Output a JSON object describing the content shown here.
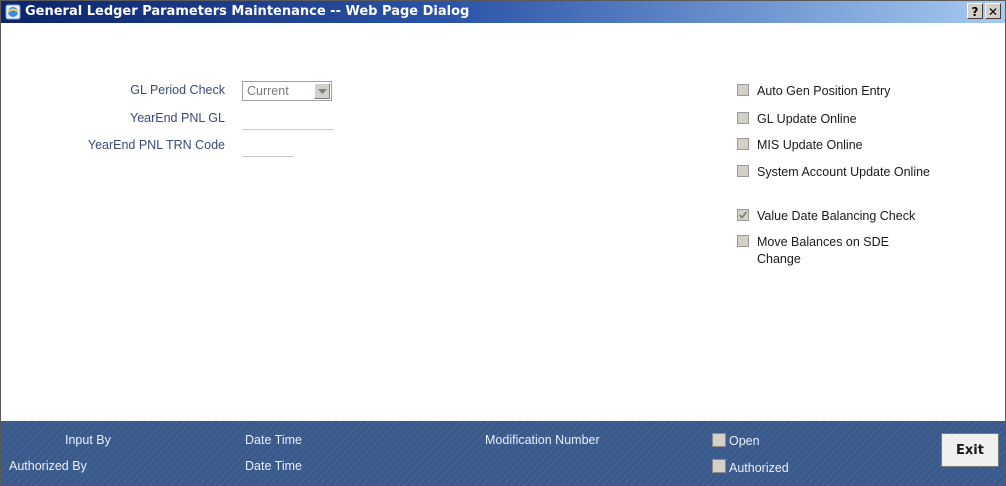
{
  "window": {
    "title": "General Ledger Parameters Maintenance -- Web Page Dialog",
    "help_label": "?",
    "close_label": "✕"
  },
  "form": {
    "gl_period_check": {
      "label": "GL Period Check",
      "value": "Current"
    },
    "yearend_pnl_gl": {
      "label": "YearEnd PNL GL",
      "value": ""
    },
    "yearend_pnl_trn_code": {
      "label": "YearEnd PNL TRN Code",
      "value": ""
    }
  },
  "options": [
    {
      "label": "Auto Gen Position Entry",
      "checked": false
    },
    {
      "label": "GL Update Online",
      "checked": false
    },
    {
      "label": "MIS Update Online",
      "checked": false
    },
    {
      "label": "System Account Update Online",
      "checked": false
    },
    {
      "label": "Value Date Balancing Check",
      "checked": true
    },
    {
      "label": "Move Balances on SDE Change",
      "checked": false
    }
  ],
  "footer": {
    "input_by": "Input By",
    "date_time_1": "Date Time",
    "authorized_by": "Authorized By",
    "date_time_2": "Date Time",
    "modification_number": "Modification Number",
    "open": "Open",
    "authorized": "Authorized",
    "exit": "Exit"
  }
}
